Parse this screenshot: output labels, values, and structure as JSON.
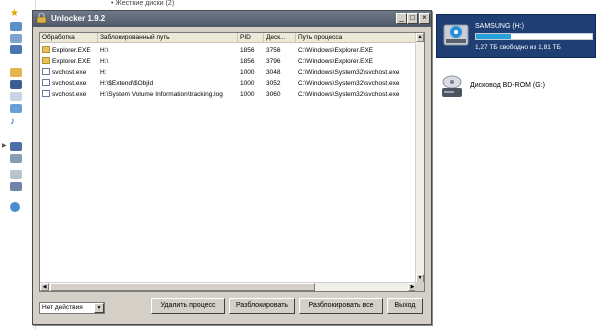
{
  "explorer": {
    "top_text": "• Жесткие диски (2)",
    "drives": [
      {
        "name": "SAMSUNG (H:)",
        "free_text": "1,27 ТБ свободно из 1,81 ТБ",
        "used_fraction": 0.3
      },
      {
        "name": "Дисковод BD-ROM (G:)"
      }
    ]
  },
  "window": {
    "title": "Unlocker 1.9.2",
    "controls": {
      "minimize": "_",
      "maximize": "□",
      "close": "×"
    },
    "columns": [
      "Обработка",
      "Заблокированный путь",
      "PID",
      "Деск...",
      "Путь процесса"
    ],
    "rows": [
      {
        "process": "Explorer.EXE",
        "icon": "folder-icon",
        "path": "H:\\",
        "pid": "1856",
        "handle": "3756",
        "proc_path": "C:\\Windows\\Explorer.EXE"
      },
      {
        "process": "Explorer.EXE",
        "icon": "folder-icon",
        "path": "H:\\",
        "pid": "1856",
        "handle": "3796",
        "proc_path": "C:\\Windows\\Explorer.EXE"
      },
      {
        "process": "svchost.exe",
        "icon": "window-icon",
        "path": "H:",
        "pid": "1000",
        "handle": "3048",
        "proc_path": "C:\\Windows\\System32\\svchost.exe"
      },
      {
        "process": "svchost.exe",
        "icon": "window-icon",
        "path": "H:\\$Extend\\$ObjId",
        "pid": "1000",
        "handle": "3052",
        "proc_path": "C:\\Windows\\System32\\svchost.exe"
      },
      {
        "process": "svchost.exe",
        "icon": "window-icon",
        "path": "H:\\System Volume Information\\tracking.log",
        "pid": "1000",
        "handle": "3060",
        "proc_path": "C:\\Windows\\System32\\svchost.exe"
      }
    ],
    "action_select": "Нет действия",
    "buttons": {
      "delete": "Удалить процесс",
      "unlock": "Разблокировать",
      "unlock_all": "Разблокировать все",
      "exit": "Выход"
    }
  }
}
